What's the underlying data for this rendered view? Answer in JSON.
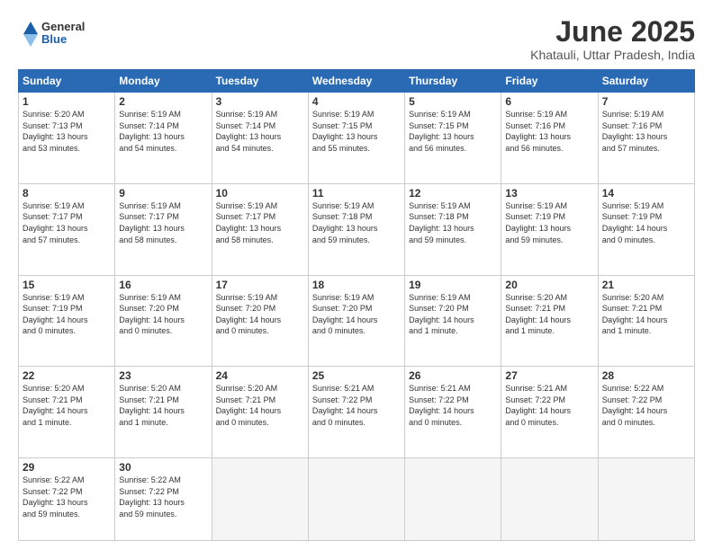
{
  "logo": {
    "general": "General",
    "blue": "Blue"
  },
  "title": "June 2025",
  "location": "Khatauli, Uttar Pradesh, India",
  "weekdays": [
    "Sunday",
    "Monday",
    "Tuesday",
    "Wednesday",
    "Thursday",
    "Friday",
    "Saturday"
  ],
  "weeks": [
    [
      {
        "day": "1",
        "info": "Sunrise: 5:20 AM\nSunset: 7:13 PM\nDaylight: 13 hours\nand 53 minutes."
      },
      {
        "day": "2",
        "info": "Sunrise: 5:19 AM\nSunset: 7:14 PM\nDaylight: 13 hours\nand 54 minutes."
      },
      {
        "day": "3",
        "info": "Sunrise: 5:19 AM\nSunset: 7:14 PM\nDaylight: 13 hours\nand 54 minutes."
      },
      {
        "day": "4",
        "info": "Sunrise: 5:19 AM\nSunset: 7:15 PM\nDaylight: 13 hours\nand 55 minutes."
      },
      {
        "day": "5",
        "info": "Sunrise: 5:19 AM\nSunset: 7:15 PM\nDaylight: 13 hours\nand 56 minutes."
      },
      {
        "day": "6",
        "info": "Sunrise: 5:19 AM\nSunset: 7:16 PM\nDaylight: 13 hours\nand 56 minutes."
      },
      {
        "day": "7",
        "info": "Sunrise: 5:19 AM\nSunset: 7:16 PM\nDaylight: 13 hours\nand 57 minutes."
      }
    ],
    [
      {
        "day": "8",
        "info": "Sunrise: 5:19 AM\nSunset: 7:17 PM\nDaylight: 13 hours\nand 57 minutes."
      },
      {
        "day": "9",
        "info": "Sunrise: 5:19 AM\nSunset: 7:17 PM\nDaylight: 13 hours\nand 58 minutes."
      },
      {
        "day": "10",
        "info": "Sunrise: 5:19 AM\nSunset: 7:17 PM\nDaylight: 13 hours\nand 58 minutes."
      },
      {
        "day": "11",
        "info": "Sunrise: 5:19 AM\nSunset: 7:18 PM\nDaylight: 13 hours\nand 59 minutes."
      },
      {
        "day": "12",
        "info": "Sunrise: 5:19 AM\nSunset: 7:18 PM\nDaylight: 13 hours\nand 59 minutes."
      },
      {
        "day": "13",
        "info": "Sunrise: 5:19 AM\nSunset: 7:19 PM\nDaylight: 13 hours\nand 59 minutes."
      },
      {
        "day": "14",
        "info": "Sunrise: 5:19 AM\nSunset: 7:19 PM\nDaylight: 14 hours\nand 0 minutes."
      }
    ],
    [
      {
        "day": "15",
        "info": "Sunrise: 5:19 AM\nSunset: 7:19 PM\nDaylight: 14 hours\nand 0 minutes."
      },
      {
        "day": "16",
        "info": "Sunrise: 5:19 AM\nSunset: 7:20 PM\nDaylight: 14 hours\nand 0 minutes."
      },
      {
        "day": "17",
        "info": "Sunrise: 5:19 AM\nSunset: 7:20 PM\nDaylight: 14 hours\nand 0 minutes."
      },
      {
        "day": "18",
        "info": "Sunrise: 5:19 AM\nSunset: 7:20 PM\nDaylight: 14 hours\nand 0 minutes."
      },
      {
        "day": "19",
        "info": "Sunrise: 5:19 AM\nSunset: 7:20 PM\nDaylight: 14 hours\nand 1 minute."
      },
      {
        "day": "20",
        "info": "Sunrise: 5:20 AM\nSunset: 7:21 PM\nDaylight: 14 hours\nand 1 minute."
      },
      {
        "day": "21",
        "info": "Sunrise: 5:20 AM\nSunset: 7:21 PM\nDaylight: 14 hours\nand 1 minute."
      }
    ],
    [
      {
        "day": "22",
        "info": "Sunrise: 5:20 AM\nSunset: 7:21 PM\nDaylight: 14 hours\nand 1 minute."
      },
      {
        "day": "23",
        "info": "Sunrise: 5:20 AM\nSunset: 7:21 PM\nDaylight: 14 hours\nand 1 minute."
      },
      {
        "day": "24",
        "info": "Sunrise: 5:20 AM\nSunset: 7:21 PM\nDaylight: 14 hours\nand 0 minutes."
      },
      {
        "day": "25",
        "info": "Sunrise: 5:21 AM\nSunset: 7:22 PM\nDaylight: 14 hours\nand 0 minutes."
      },
      {
        "day": "26",
        "info": "Sunrise: 5:21 AM\nSunset: 7:22 PM\nDaylight: 14 hours\nand 0 minutes."
      },
      {
        "day": "27",
        "info": "Sunrise: 5:21 AM\nSunset: 7:22 PM\nDaylight: 14 hours\nand 0 minutes."
      },
      {
        "day": "28",
        "info": "Sunrise: 5:22 AM\nSunset: 7:22 PM\nDaylight: 14 hours\nand 0 minutes."
      }
    ],
    [
      {
        "day": "29",
        "info": "Sunrise: 5:22 AM\nSunset: 7:22 PM\nDaylight: 13 hours\nand 59 minutes."
      },
      {
        "day": "30",
        "info": "Sunrise: 5:22 AM\nSunset: 7:22 PM\nDaylight: 13 hours\nand 59 minutes."
      },
      {
        "day": "",
        "info": ""
      },
      {
        "day": "",
        "info": ""
      },
      {
        "day": "",
        "info": ""
      },
      {
        "day": "",
        "info": ""
      },
      {
        "day": "",
        "info": ""
      }
    ]
  ]
}
